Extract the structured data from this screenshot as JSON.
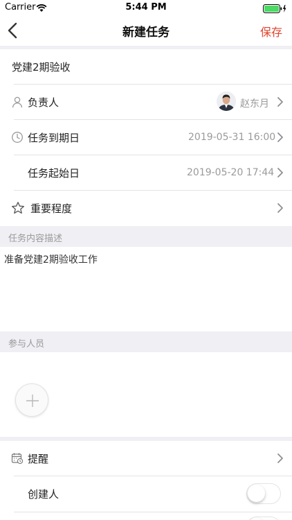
{
  "status_bar": {
    "carrier": "Carrier",
    "time": "5:44 PM"
  },
  "nav": {
    "title": "新建任务",
    "save_label": "保存"
  },
  "task": {
    "name": "党建2期验收"
  },
  "owner": {
    "label": "负责人",
    "name": "赵东月"
  },
  "due_date": {
    "label": "任务到期日",
    "value": "2019-05-31 16:00"
  },
  "start_date": {
    "label": "任务起始日",
    "value": "2019-05-20 17:44"
  },
  "importance": {
    "label": "重要程度"
  },
  "description": {
    "header": "任务内容描述",
    "text": "准备党建2期验收工作"
  },
  "participants": {
    "header": "参与人员"
  },
  "reminder": {
    "label": "提醒"
  },
  "creator": {
    "label": "创建人",
    "enabled": false
  },
  "colors": {
    "accent": "#e0442d",
    "background_band": "#efeff4",
    "secondary_text": "#9a9a9a"
  }
}
